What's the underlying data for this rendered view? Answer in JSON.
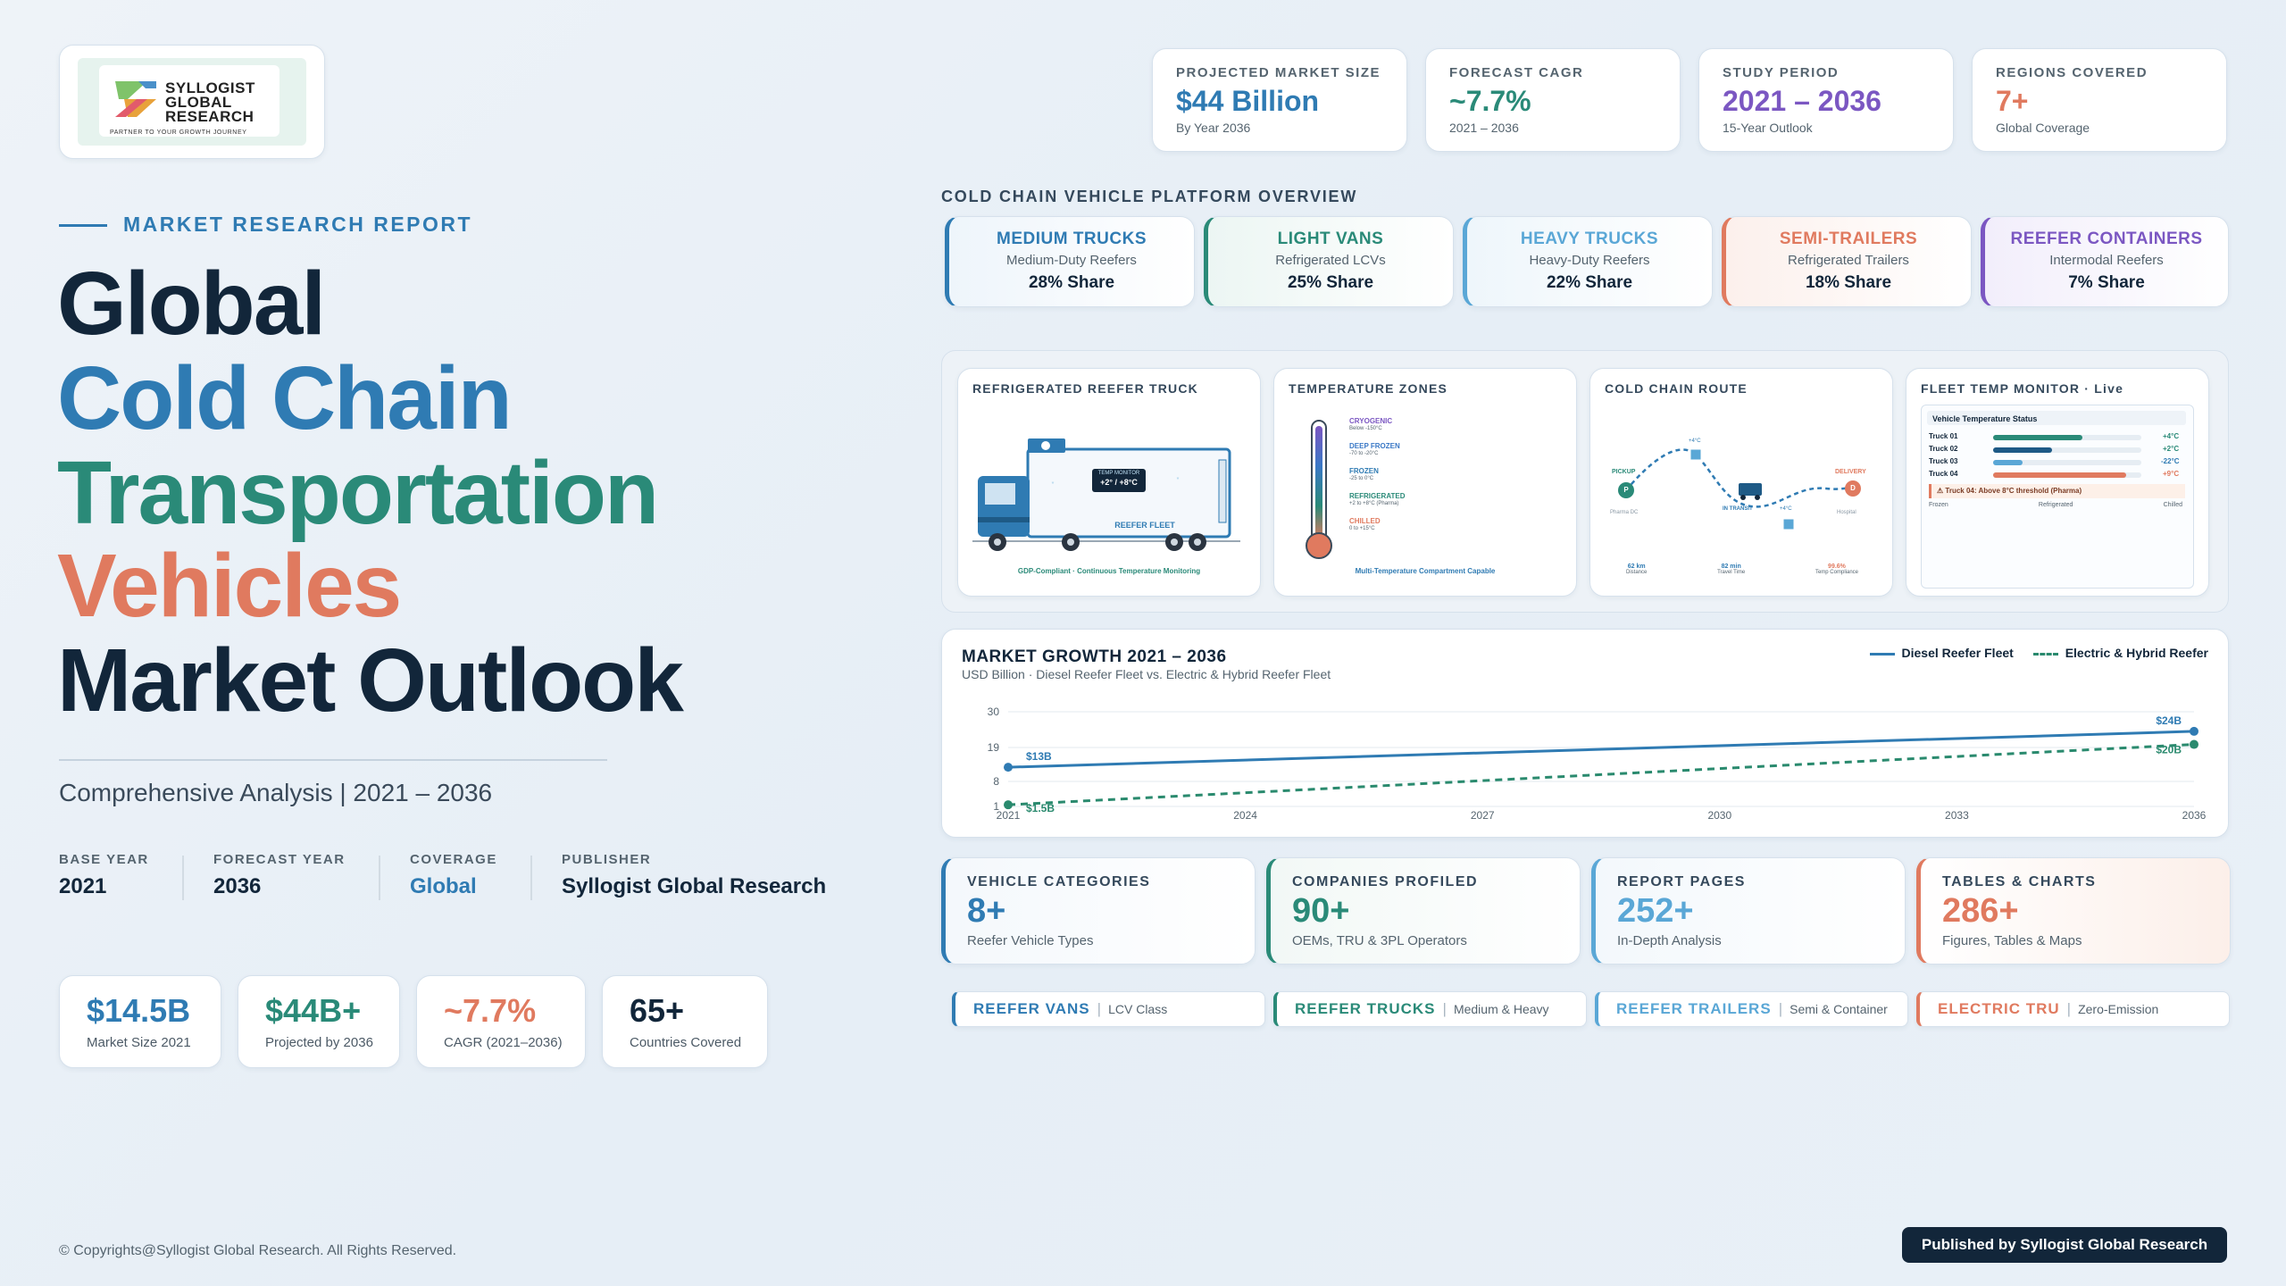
{
  "brand": {
    "logo_lines": [
      "SYLLOGIST",
      "GLOBAL",
      "RESEARCH"
    ],
    "logo_tagline": "PARTNER TO YOUR GROWTH JOURNEY"
  },
  "hero": {
    "eyebrow": "MARKET RESEARCH REPORT",
    "title_lines": [
      "Global",
      "Cold Chain",
      "Transportation",
      "Vehicles",
      "Market Outlook"
    ],
    "subtitle": "Comprehensive Analysis | 2021 – 2036",
    "colors": {
      "dark": "#12263a",
      "blue": "#2f7bb3",
      "teal": "#2a8a78",
      "orange": "#e07a5f"
    }
  },
  "meta": [
    {
      "label": "BASE YEAR",
      "value": "2021"
    },
    {
      "label": "FORECAST YEAR",
      "value": "2036"
    },
    {
      "label": "COVERAGE",
      "value": "Global"
    },
    {
      "label": "PUBLISHER",
      "value": "Syllogist Global Research"
    }
  ],
  "stats": [
    {
      "value": "$14.5B",
      "label": "Market Size 2021"
    },
    {
      "value": "$44B+",
      "label": "Projected by 2036"
    },
    {
      "value": "~7.7%",
      "label": "CAGR (2021–2036)"
    },
    {
      "value": "65+",
      "label": "Countries Covered"
    }
  ],
  "kpis": [
    {
      "label": "PROJECTED MARKET SIZE",
      "value": "$44 Billion",
      "sub": "By Year 2036"
    },
    {
      "label": "FORECAST CAGR",
      "value": "~7.7%",
      "sub": "2021 – 2036"
    },
    {
      "label": "STUDY PERIOD",
      "value": "2021 – 2036",
      "sub": "15-Year Outlook"
    },
    {
      "label": "REGIONS COVERED",
      "value": "7+",
      "sub": "Global Coverage"
    }
  ],
  "platform": {
    "title": "COLD CHAIN VEHICLE PLATFORM OVERVIEW",
    "items": [
      {
        "name": "MEDIUM TRUCKS",
        "sub": "Medium-Duty Reefers",
        "share": "28% Share"
      },
      {
        "name": "LIGHT VANS",
        "sub": "Refrigerated LCVs",
        "share": "25% Share"
      },
      {
        "name": "HEAVY TRUCKS",
        "sub": "Heavy-Duty Reefers",
        "share": "22% Share"
      },
      {
        "name": "SEMI-TRAILERS",
        "sub": "Refrigerated Trailers",
        "share": "18% Share"
      },
      {
        "name": "REEFER CONTAINERS",
        "sub": "Intermodal Reefers",
        "share": "7% Share"
      }
    ]
  },
  "panels": {
    "truck": {
      "title": "REFRIGERATED REEFER TRUCK",
      "monitor_label": "TEMP MONITOR",
      "monitor_value": "+2° / +8°C",
      "body_label": "REEFER FLEET",
      "caption": "GDP-Compliant · Continuous Temperature Monitoring"
    },
    "zones": {
      "title": "TEMPERATURE ZONES",
      "items": [
        {
          "name": "CRYOGENIC",
          "range": "Below -150°C"
        },
        {
          "name": "DEEP FROZEN",
          "range": "-70 to -20°C"
        },
        {
          "name": "FROZEN",
          "range": "-25 to 0°C"
        },
        {
          "name": "REFRIGERATED",
          "range": "+2 to +8°C (Pharma)"
        },
        {
          "name": "CHILLED",
          "range": "0 to +15°C"
        }
      ],
      "caption": "Multi-Temperature Compartment Capable"
    },
    "route": {
      "title": "COLD CHAIN ROUTE",
      "pickup": "PICKUP",
      "pickup_sub": "Pharma DC",
      "pickup_marker": "P",
      "delivery": "DELIVERY",
      "delivery_sub": "Hospital",
      "delivery_marker": "D",
      "in_transit": "IN TRANSIT",
      "temp_top": "+4°C",
      "temp_mid": "+4°C",
      "stats": [
        {
          "value": "62 km",
          "label": "Distance"
        },
        {
          "value": "82 min",
          "label": "Travel Time"
        },
        {
          "value": "99.6%",
          "label": "Temp Compliance"
        }
      ]
    },
    "monitor": {
      "title": "FLEET TEMP MONITOR · Live",
      "heading": "Vehicle Temperature Status",
      "rows": [
        {
          "name": "Truck 01",
          "level": 0.6,
          "temp": "+4°C"
        },
        {
          "name": "Truck 02",
          "level": 0.4,
          "temp": "+2°C"
        },
        {
          "name": "Truck 03",
          "level": 0.2,
          "temp": "-22°C"
        },
        {
          "name": "Truck 04",
          "level": 0.9,
          "temp": "+9°C"
        }
      ],
      "alert": "⚠ Truck 04: Above 8°C threshold (Pharma)",
      "scale": [
        "Frozen",
        "Refrigerated",
        "Chilled"
      ]
    }
  },
  "growth": {
    "title": "MARKET GROWTH 2021 – 2036",
    "subtitle": "USD Billion · Diesel Reefer Fleet vs. Electric & Hybrid Reefer Fleet",
    "legend": [
      "Diesel Reefer Fleet",
      "Electric & Hybrid Reefer"
    ]
  },
  "chart_data": {
    "type": "line",
    "x": [
      2021,
      2036
    ],
    "x_ticks": [
      "2021",
      "2024",
      "2027",
      "2030",
      "2033",
      "2036"
    ],
    "y_ticks": [
      "1",
      "8",
      "19",
      "30"
    ],
    "ylim": [
      1,
      30
    ],
    "series": [
      {
        "name": "Diesel Reefer Fleet",
        "values": [
          13,
          24
        ],
        "labels": [
          "$13B",
          "$24B"
        ],
        "color": "#2f7bb3"
      },
      {
        "name": "Electric & Hybrid Reefer",
        "values": [
          1.5,
          20
        ],
        "labels": [
          "$1.5B",
          "$20B"
        ],
        "color": "#2a8a6e"
      }
    ],
    "title": "MARKET GROWTH 2021 – 2036",
    "ylabel": "",
    "xlabel": ""
  },
  "bottom_stats": [
    {
      "label": "VEHICLE CATEGORIES",
      "value": "8+",
      "sub": "Reefer Vehicle Types"
    },
    {
      "label": "COMPANIES PROFILED",
      "value": "90+",
      "sub": "OEMs, TRU & 3PL Operators"
    },
    {
      "label": "REPORT PAGES",
      "value": "252+",
      "sub": "In-Depth Analysis"
    },
    {
      "label": "TABLES & CHARTS",
      "value": "286+",
      "sub": "Figures, Tables & Maps"
    }
  ],
  "tags": [
    {
      "name": "REEFER VANS",
      "sub": "LCV Class"
    },
    {
      "name": "REEFER TRUCKS",
      "sub": "Medium & Heavy"
    },
    {
      "name": "REEFER TRAILERS",
      "sub": "Semi & Container"
    },
    {
      "name": "ELECTRIC TRU",
      "sub": "Zero-Emission"
    }
  ],
  "tag_separator": "|",
  "footer": {
    "copyright": "© Copyrights@Syllogist Global Research. All Rights Reserved.",
    "published": "Published by Syllogist Global Research"
  }
}
